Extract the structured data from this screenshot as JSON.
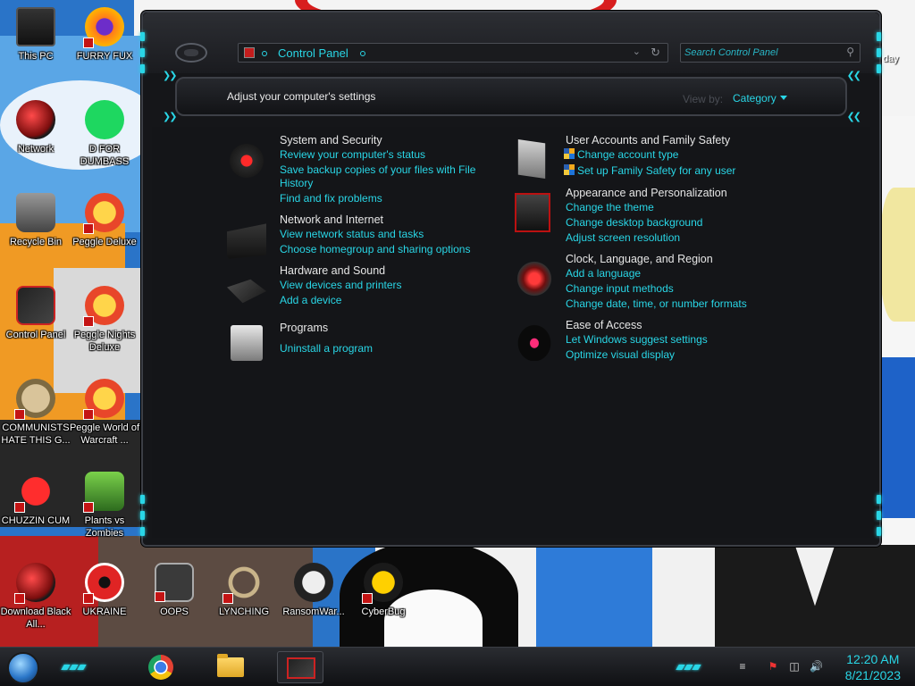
{
  "desktop": {
    "icons": [
      {
        "label": "This PC"
      },
      {
        "label": "FURRY FUX"
      },
      {
        "label": "Network"
      },
      {
        "label": "D FOR DUMBASS"
      },
      {
        "label": "Recycle Bin"
      },
      {
        "label": "Peggle Deluxe"
      },
      {
        "label": "Control Panel"
      },
      {
        "label": "Peggle Nights Deluxe"
      },
      {
        "label": "COMMUNISTS HATE THIS G..."
      },
      {
        "label": "Peggle World of Warcraft ..."
      },
      {
        "label": "CHUZZIN CUM"
      },
      {
        "label": "Plants vs Zombies"
      },
      {
        "label": "Download Black All..."
      },
      {
        "label": "UKRAINE"
      },
      {
        "label": "OOPS"
      },
      {
        "label": "LYNCHING"
      },
      {
        "label": "RansomWar..."
      },
      {
        "label": "CyberBug"
      }
    ],
    "partial_label_right": "day"
  },
  "window": {
    "address": {
      "location": "Control Panel"
    },
    "search": {
      "placeholder": "Search Control Panel"
    },
    "header": {
      "title": "Adjust your computer's settings",
      "view_by_label": "View by:",
      "view_by_value": "Category"
    },
    "categories_left": [
      {
        "title": "System and Security",
        "icon": "security-icon",
        "links": [
          "Review your computer's status",
          "Save backup copies of your files with File",
          "History",
          "Find and fix problems"
        ]
      },
      {
        "title": "Network and Internet",
        "icon": "network-icon",
        "links": [
          "View network status and tasks",
          "Choose homegroup and sharing options"
        ]
      },
      {
        "title": "Hardware and Sound",
        "icon": "hardware-icon",
        "links": [
          "View devices and printers",
          "Add a device"
        ]
      },
      {
        "title": "Programs",
        "icon": "programs-icon",
        "links": [
          "Uninstall a program"
        ]
      }
    ],
    "categories_right": [
      {
        "title": "User Accounts and Family Safety",
        "icon": "user-accounts-icon",
        "links": [
          "Change account type",
          "Set up Family Safety for any user"
        ]
      },
      {
        "title": "Appearance and Personalization",
        "icon": "appearance-icon",
        "links": [
          "Change the theme",
          "Change desktop background",
          "Adjust screen resolution"
        ]
      },
      {
        "title": "Clock, Language, and Region",
        "icon": "clock-icon",
        "links": [
          "Add a language",
          "Change input methods",
          "Change date, time, or number formats"
        ]
      },
      {
        "title": "Ease of Access",
        "icon": "ease-of-access-icon",
        "links": [
          "Let Windows suggest settings",
          "Optimize visual display"
        ]
      }
    ]
  },
  "taskbar": {
    "apps": [
      "Google Chrome",
      "File Explorer",
      "Control Panel"
    ],
    "clock": {
      "time": "12:20 AM",
      "date": "8/21/2023"
    }
  },
  "colors": {
    "accent": "#29d6e6",
    "window_bg": "#151619",
    "text": "#e6e6e6"
  }
}
